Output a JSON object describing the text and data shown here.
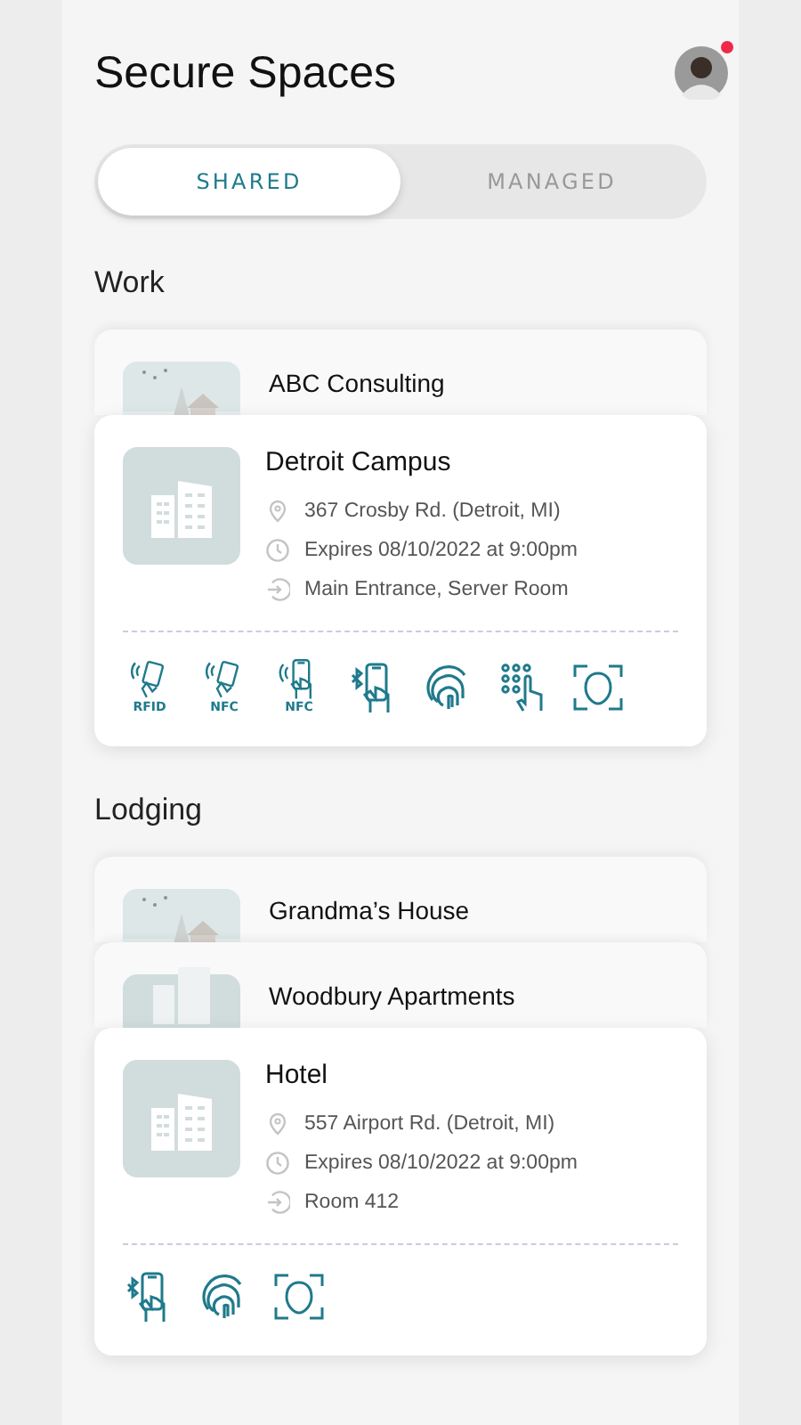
{
  "header": {
    "title": "Secure Spaces",
    "avatar": {
      "notification": true
    }
  },
  "tabs": [
    {
      "label": "SHARED",
      "selected": true
    },
    {
      "label": "MANAGED",
      "selected": false
    }
  ],
  "groups": [
    {
      "title": "Work",
      "stack": [
        {
          "kind": "picture",
          "name": "ABC Consulting"
        }
      ],
      "card": {
        "name": "Detroit Campus",
        "address": "367 Crosby Rd. (Detroit, MI)",
        "expires": "Expires 08/10/2022 at 9:00pm",
        "doors": "Main Entrance, Server Room",
        "methods": [
          {
            "kind": "rfid-card",
            "label": "RFID"
          },
          {
            "kind": "nfc-card",
            "label": "NFC"
          },
          {
            "kind": "nfc-phone",
            "label": "NFC"
          },
          {
            "kind": "bluetooth-phone"
          },
          {
            "kind": "fingerprint"
          },
          {
            "kind": "keypad"
          },
          {
            "kind": "face"
          }
        ]
      }
    },
    {
      "title": "Lodging",
      "stack": [
        {
          "kind": "picture",
          "name": "Grandma’s House"
        },
        {
          "kind": "building",
          "name": "Woodbury Apartments"
        }
      ],
      "card": {
        "name": "Hotel",
        "address": "557 Airport Rd. (Detroit, MI)",
        "expires": "Expires 08/10/2022 at 9:00pm",
        "doors": "Room 412",
        "methods": [
          {
            "kind": "bluetooth-phone"
          },
          {
            "kind": "fingerprint"
          },
          {
            "kind": "face"
          }
        ]
      }
    }
  ]
}
